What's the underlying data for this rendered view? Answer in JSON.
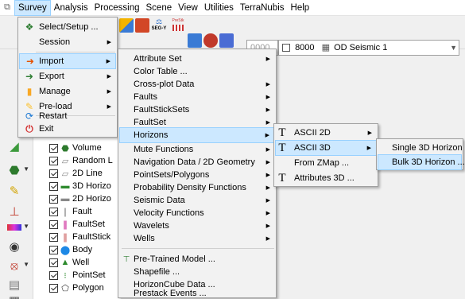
{
  "menubar": {
    "items": [
      "Survey",
      "Analysis",
      "Processing",
      "Scene",
      "View",
      "Utilities",
      "TerraNubis",
      "Help"
    ]
  },
  "toolbar": {
    "icon_label_segy": "SEG-Y",
    "icon_label_prestack": "PreStk",
    "combo_value_left": "0000",
    "combo_value": "8000",
    "combo_dataset": "OD Seismic 1"
  },
  "survey_menu": {
    "items": [
      {
        "label": "Select/Setup ...",
        "submenu": false,
        "icon": "select-setup-icon"
      },
      {
        "label": "Session",
        "submenu": true,
        "icon": ""
      },
      {
        "label": "Import",
        "submenu": true,
        "icon": "import-icon"
      },
      {
        "label": "Export",
        "submenu": true,
        "icon": "export-icon"
      },
      {
        "label": "Manage",
        "submenu": true,
        "icon": "manage-icon"
      },
      {
        "label": "Pre-load",
        "submenu": true,
        "icon": "preload-icon"
      },
      {
        "label": "Restart",
        "submenu": false,
        "icon": "restart-icon"
      },
      {
        "label": "Exit",
        "submenu": false,
        "icon": "exit-icon"
      }
    ]
  },
  "import_menu": {
    "items": [
      {
        "label": "Attribute Set",
        "submenu": true
      },
      {
        "label": "Color Table ...",
        "submenu": false
      },
      {
        "label": "Cross-plot Data",
        "submenu": true
      },
      {
        "label": "Faults",
        "submenu": true
      },
      {
        "label": "FaultStickSets",
        "submenu": true
      },
      {
        "label": "FaultSet",
        "submenu": true
      },
      {
        "label": "Horizons",
        "submenu": true
      },
      {
        "label": "Mute Functions",
        "submenu": true
      },
      {
        "label": "Navigation Data / 2D Geometry",
        "submenu": true
      },
      {
        "label": "PointSets/Polygons",
        "submenu": true
      },
      {
        "label": "Probability Density Functions",
        "submenu": true
      },
      {
        "label": "Seismic Data",
        "submenu": true
      },
      {
        "label": "Velocity Functions",
        "submenu": true
      },
      {
        "label": "Wavelets",
        "submenu": true
      },
      {
        "label": "Wells",
        "submenu": true
      },
      {
        "label": "Pre-Trained Model ...",
        "submenu": false
      },
      {
        "label": "Shapefile ...",
        "submenu": false
      },
      {
        "label": "HorizonCube Data ...",
        "submenu": false
      },
      {
        "label": "Prestack Events ...",
        "submenu": false
      }
    ]
  },
  "horizons_menu": {
    "items": [
      {
        "label": "ASCII 2D",
        "submenu": true
      },
      {
        "label": "ASCII 3D",
        "submenu": true
      },
      {
        "label": "From ZMap ...",
        "submenu": false
      },
      {
        "label": "Attributes 3D ...",
        "submenu": false
      }
    ]
  },
  "ascii3d_menu": {
    "items": [
      {
        "label": "Single 3D Horizon ..."
      },
      {
        "label": "Bulk 3D Horizon ..."
      }
    ]
  },
  "tree": {
    "items": [
      "Volume",
      "Random L",
      "2D Line",
      "3D Horizo",
      "2D Horizo",
      "Fault",
      "FaultSet",
      "FaultStick",
      "Body",
      "Well",
      "PointSet",
      "Polygon"
    ]
  },
  "colors": {
    "highlight": "#cce8ff",
    "highlight_border": "#99d1ff",
    "menu_bg": "#f2f2f2"
  }
}
